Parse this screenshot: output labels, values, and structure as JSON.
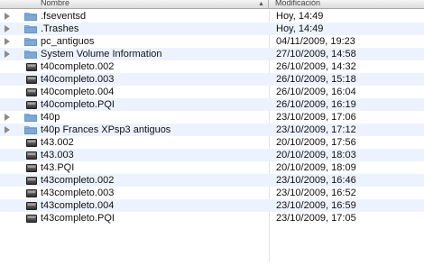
{
  "header": {
    "name_label": "Nombre",
    "modified_label": "Modificación",
    "sort_indicator": "▲"
  },
  "colors": {
    "alt_row": "#edf3fe",
    "folder_blue": "#7fa8d6"
  },
  "rows": [
    {
      "name": ".fseventsd",
      "date": "Hoy, 14:49",
      "kind": "folder-icon",
      "expandable": true
    },
    {
      "name": ".Trashes",
      "date": "Hoy, 14:49",
      "kind": "folder-icon",
      "expandable": true
    },
    {
      "name": "pc_antiguos",
      "date": "04/11/2009, 19:23",
      "kind": "folder-icon",
      "expandable": true
    },
    {
      "name": "System Volume Information",
      "date": "27/10/2009, 14:58",
      "kind": "folder-icon",
      "expandable": true
    },
    {
      "name": "t40completo.002",
      "date": "26/10/2009, 14:32",
      "kind": "file-icon",
      "expandable": false
    },
    {
      "name": "t40completo.003",
      "date": "26/10/2009, 15:18",
      "kind": "file-icon",
      "expandable": false
    },
    {
      "name": "t40completo.004",
      "date": "26/10/2009, 16:04",
      "kind": "file-icon",
      "expandable": false
    },
    {
      "name": "t40completo.PQI",
      "date": "26/10/2009, 16:19",
      "kind": "file-icon",
      "expandable": false
    },
    {
      "name": "t40p",
      "date": "23/10/2009, 17:06",
      "kind": "folder-icon",
      "expandable": true
    },
    {
      "name": "t40p Frances XPsp3 antiguos",
      "date": "23/10/2009, 17:12",
      "kind": "folder-icon",
      "expandable": true
    },
    {
      "name": "t43.002",
      "date": "20/10/2009, 17:56",
      "kind": "file-icon",
      "expandable": false
    },
    {
      "name": "t43.003",
      "date": "20/10/2009, 18:03",
      "kind": "file-icon",
      "expandable": false
    },
    {
      "name": "t43.PQI",
      "date": "20/10/2009, 18:09",
      "kind": "file-icon",
      "expandable": false
    },
    {
      "name": "t43completo.002",
      "date": "23/10/2009, 16:46",
      "kind": "file-icon",
      "expandable": false
    },
    {
      "name": "t43completo.003",
      "date": "23/10/2009, 16:52",
      "kind": "file-icon",
      "expandable": false
    },
    {
      "name": "t43completo.004",
      "date": "23/10/2009, 16:59",
      "kind": "file-icon",
      "expandable": false
    },
    {
      "name": "t43completo.PQI",
      "date": "23/10/2009, 17:05",
      "kind": "file-icon",
      "expandable": false
    }
  ]
}
